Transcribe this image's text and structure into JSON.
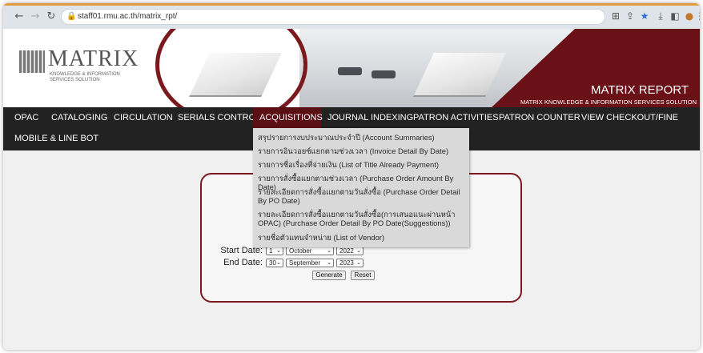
{
  "browser": {
    "url": "staff01.rmu.ac.th/matrix_rpt/",
    "icons": [
      "back-icon",
      "forward-icon",
      "reload-icon",
      "lock-icon",
      "translate-icon",
      "share-icon",
      "star-icon",
      "download-icon",
      "sidepanel-icon",
      "profile-icon",
      "menu-icon"
    ],
    "accent_color": "#e39a3a"
  },
  "banner": {
    "logo_text": "MATRIX",
    "logo_sub_1": "KNOWLEDGE & INFORMATION",
    "logo_sub_2": "SERVICES SOLUTION",
    "report_title": "MATRIX REPORT",
    "report_subtitle": "MATRIX KNOWLEDGE & INFORMATION SERVICES SOLUTION",
    "brand_color": "#6a1017"
  },
  "menu": {
    "items": [
      "OPAC",
      "CATALOGING",
      "CIRCULATION",
      "SERIALS CONTROL",
      "ACQUISITIONS",
      "JOURNAL INDEXING",
      "PATRON ACTIVITIES",
      "PATRON COUNTER",
      "VIEW CHECKOUT/FINE",
      "MOBILE & LINE BOT"
    ],
    "active": "ACQUISITIONS",
    "bar_color": "#222222",
    "active_color": "#5a0f15"
  },
  "dropdown": {
    "items": [
      "สรุปรายการงบประมาณประจำปี (Account Summaries)",
      "รายการอินวอยซ์แยกตามช่วงเวลา (Invoice Detail By Date)",
      "รายการชื่อเรื่องที่จ่ายเงิน (List of Title Already Payment)",
      "รายการสั่งซื้อแยกตามช่วงเวลา (Purchase Order Amount By Date)",
      "รายละเอียดการสั่งซื้อแยกตามวันสั่งซื้อ (Purchase Order Detail By PO Date)",
      "รายละเอียดการสั่งซื้อแยกตามวันสั่งซื้อ(การเสนอแนะผ่านหน้า OPAC) (Purchase Order Detail By PO Date(Suggestions))",
      "รายชื่อตัวแทนจำหน่าย (List of Vendor)"
    ]
  },
  "form": {
    "start_label": "Start Date:",
    "end_label": "End Date:",
    "start_day": "1",
    "start_month": "October",
    "start_year": "2022",
    "end_day": "30",
    "end_month": "September",
    "end_year": "2023",
    "generate_label": "Generate",
    "reset_label": "Reset"
  }
}
